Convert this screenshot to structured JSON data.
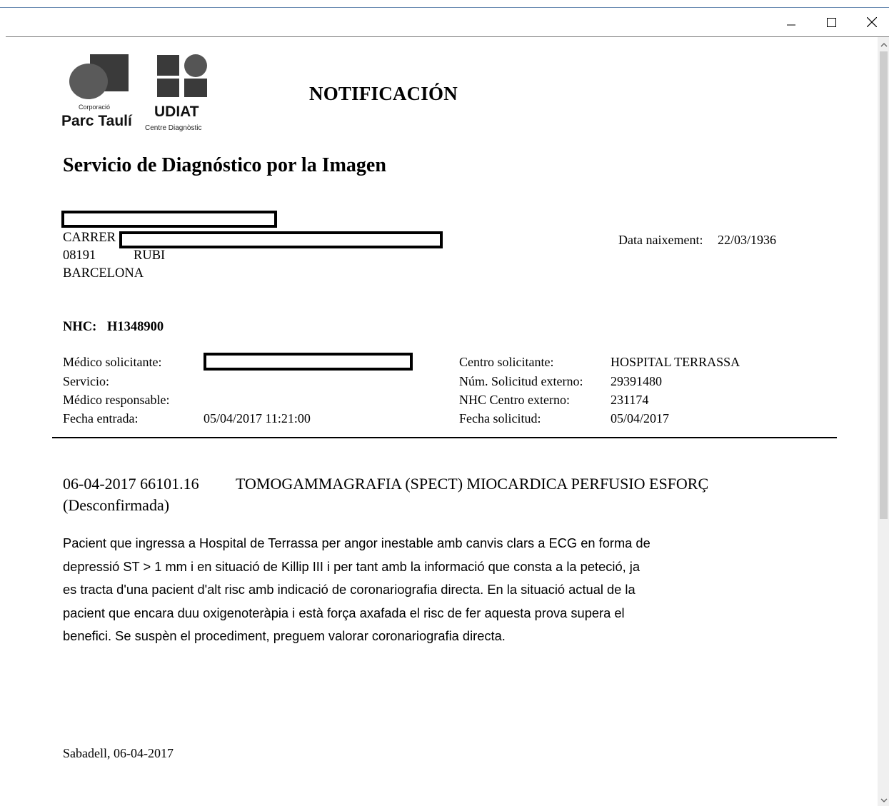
{
  "window": {
    "minimize_icon": "minimize-icon",
    "maximize_icon": "maximize-icon",
    "close_icon": "close-icon"
  },
  "logos": {
    "parc_small": "Corporació",
    "parc_name": "Parc Taulí",
    "udiat_name": "UDIAT",
    "udiat_sub": "Centre Diagnòstic"
  },
  "header": {
    "title": "NOTIFICACIÓN",
    "service": "Servicio de Diagnóstico por la Imagen"
  },
  "patient": {
    "address_prefix": "CARRER",
    "postal_code": "08191",
    "city": "RUBI",
    "province": "BARCELONA",
    "birth_label": "Data naixement:",
    "birth_date": "22/03/1936",
    "nhc_label": "NHC:",
    "nhc_value": "H1348900"
  },
  "request": {
    "left": [
      {
        "label": "Médico solicitante:",
        "value": ""
      },
      {
        "label": "Servicio:",
        "value": ""
      },
      {
        "label": "Médico responsable:",
        "value": ""
      },
      {
        "label": "Fecha entrada:",
        "value": "05/04/2017 11:21:00"
      }
    ],
    "right": [
      {
        "label": "Centro solicitante:",
        "value": "HOSPITAL TERRASSA"
      },
      {
        "label": "Núm. Solicitud externo:",
        "value": "29391480"
      },
      {
        "label": "NHC Centro externo:",
        "value": "231174"
      },
      {
        "label": "Fecha solicitud:",
        "value": "05/04/2017"
      }
    ]
  },
  "procedure": {
    "date_code": "06-04-2017 66101.16",
    "name": "TOMOGAMMAGRAFIA (SPECT) MIOCARDICA PERFUSIO ESFORÇ",
    "status": "(Desconfirmada)"
  },
  "report": {
    "lines": [
      "Pacient que ingressa a Hospital de Terrassa per angor inestable amb canvis clars a ECG en forma de",
      "depressió ST > 1 mm i en situació de Killip III i per tant amb la informació que consta a la peteció, ja",
      "es tracta d'una pacient d'alt risc amb indicació de coronariografia directa. En la situació actual de la",
      "pacient que encara duu oxigenoteràpia i està força axafada el risc de fer aquesta prova supera el",
      "benefici. Se suspèn el procediment, preguem valorar coronariografia directa."
    ]
  },
  "footer": {
    "place_date": "Sabadell, 06-04-2017"
  },
  "colors": {
    "logo_gray": "#4a4a4a",
    "scrollbar_track": "#f0f0f0",
    "scrollbar_thumb": "#cdcdcd"
  }
}
